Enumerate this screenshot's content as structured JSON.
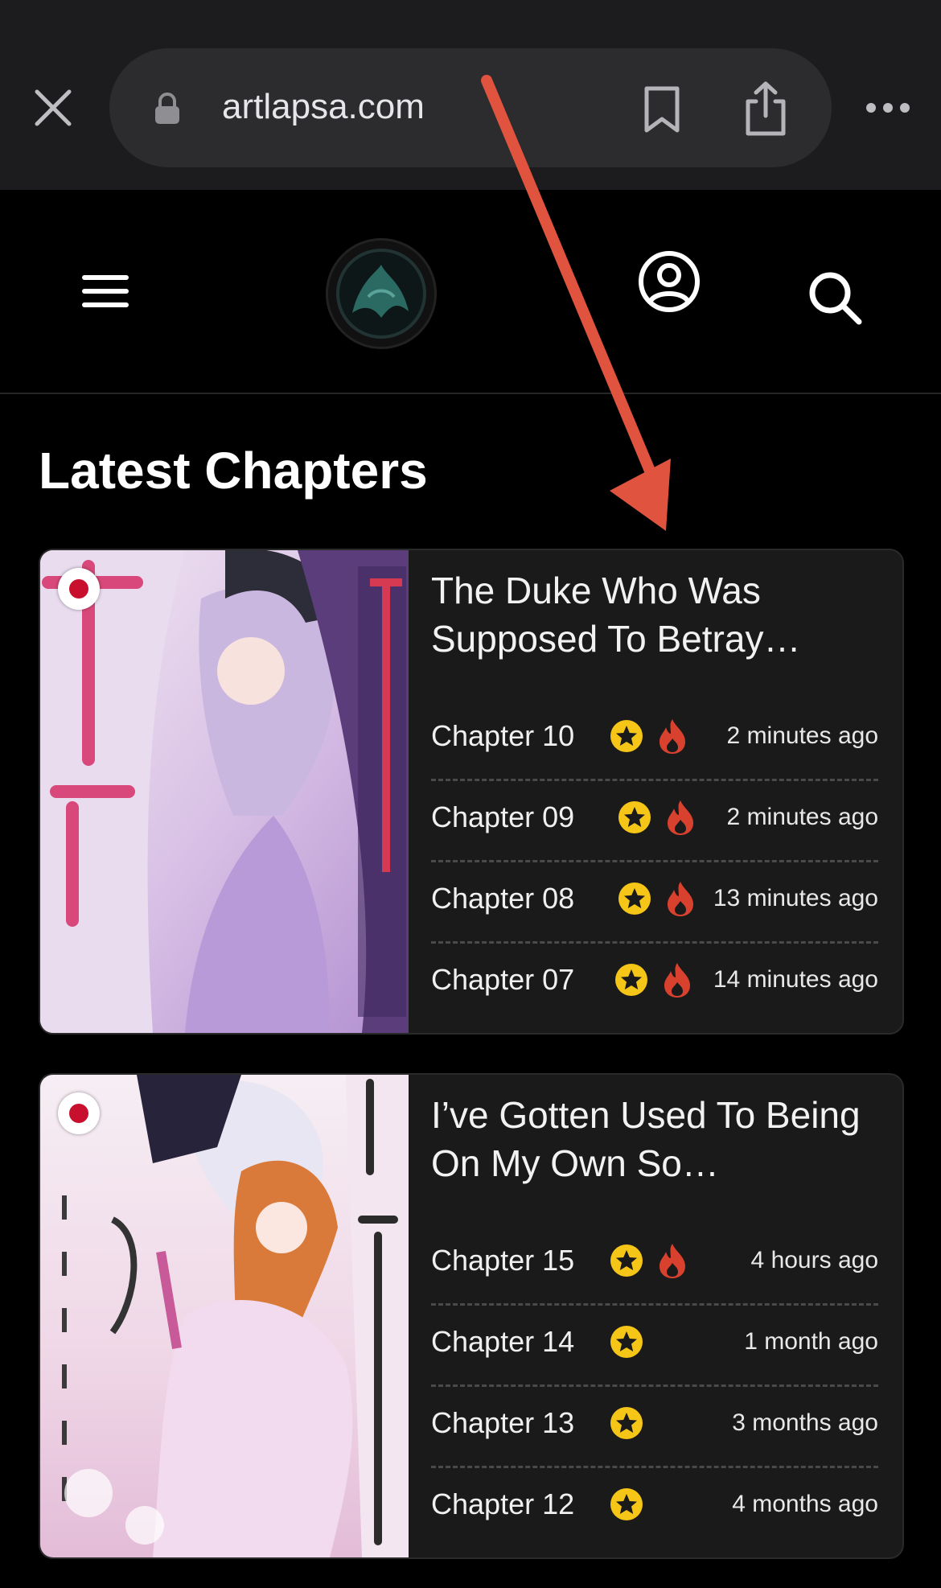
{
  "browser": {
    "url": "artlapsa.com",
    "icons": [
      "close-icon",
      "lock-icon",
      "bookmark-icon",
      "share-icon",
      "more-icon"
    ]
  },
  "header": {
    "icons": [
      "menu-icon",
      "logo",
      "account-icon",
      "search-icon"
    ]
  },
  "section": {
    "title": "Latest Chapters"
  },
  "series": [
    {
      "title": "The Duke Who Was Supposed To Betray…",
      "flag": "japan-flag",
      "chapters": [
        {
          "label": "Chapter 10",
          "time": "2 minutes ago",
          "star": true,
          "hot": true
        },
        {
          "label": "Chapter 09",
          "time": "2 minutes ago",
          "star": true,
          "hot": true
        },
        {
          "label": "Chapter 08",
          "time": "13 minutes ago",
          "star": true,
          "hot": true
        },
        {
          "label": "Chapter 07",
          "time": "14 minutes ago",
          "star": true,
          "hot": true
        }
      ]
    },
    {
      "title": "I’ve Gotten Used To Being On My Own So…",
      "flag": "japan-flag",
      "chapters": [
        {
          "label": "Chapter 15",
          "time": "4 hours ago",
          "star": true,
          "hot": true
        },
        {
          "label": "Chapter 14",
          "time": "1 month ago",
          "star": true,
          "hot": false
        },
        {
          "label": "Chapter 13",
          "time": "3 months ago",
          "star": true,
          "hot": false
        },
        {
          "label": "Chapter 12",
          "time": "4 months ago",
          "star": true,
          "hot": false
        }
      ]
    }
  ],
  "colors": {
    "background": "#000000",
    "card": "#1a1a1a",
    "star": "#f5c518",
    "fire": "#d9412f",
    "arrow": "#e0533f"
  }
}
